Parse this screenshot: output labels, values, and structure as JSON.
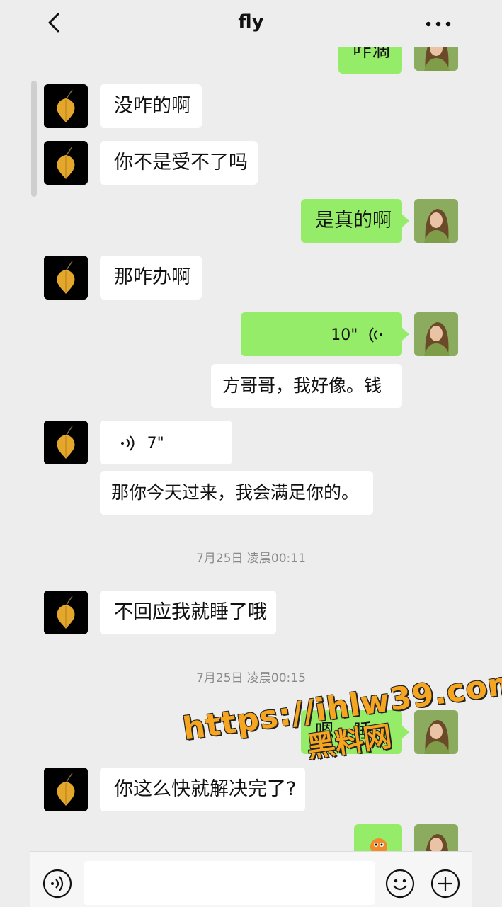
{
  "header": {
    "title": "fly"
  },
  "messages": {
    "m0_partial": "咋滴",
    "m1": "没咋的啊",
    "m2": "你不是受不了吗",
    "m3": "是真的啊",
    "m4": "那咋办啊",
    "m5_voice_duration": "10\"",
    "m6": "方哥哥，我好像。钱",
    "m7_voice_duration": "7\"",
    "m8": "那你今天过来，我会满足你的。",
    "t1": "7月25日 凌晨00:11",
    "m9": "不回应我就睡了哦",
    "t2": "7月25日 凌晨00:15",
    "m10_partial": "嗯，睡",
    "m11": "你这么快就解决完了?",
    "m12_icon": "emoji-sticker"
  },
  "watermark": {
    "url": "https://ihlw39.com",
    "name": "黑料网"
  },
  "colors": {
    "self_bubble": "#95ec69",
    "other_bubble": "#ffffff",
    "background": "#ededed",
    "watermark": "#f5a51f"
  }
}
